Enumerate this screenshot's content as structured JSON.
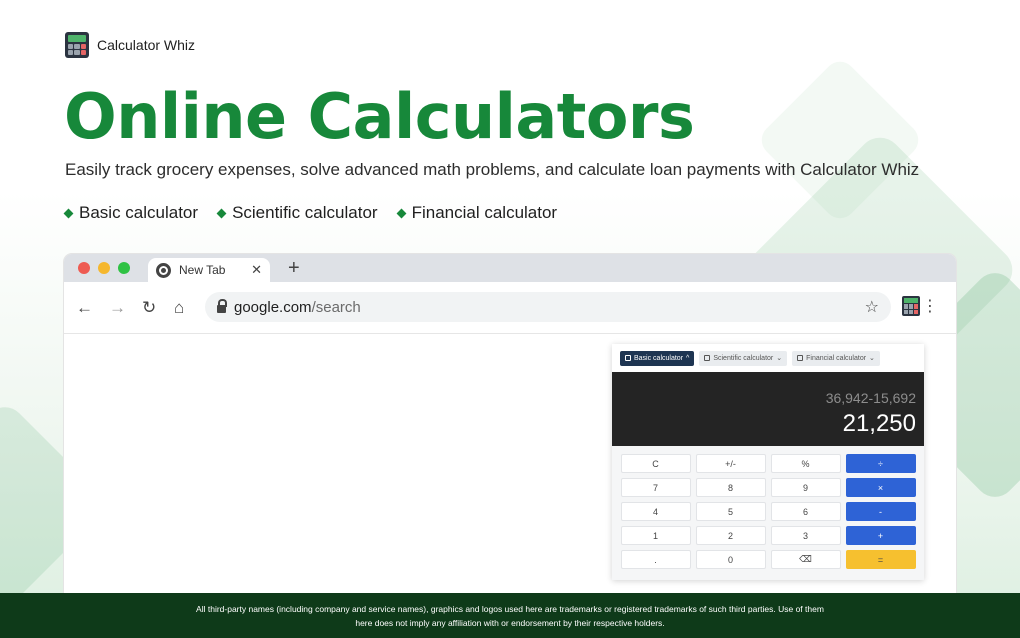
{
  "brand": {
    "name": "Calculator Whiz"
  },
  "headline": "Online Calculators",
  "subheadline": "Easily track grocery expenses, solve advanced math problems, and calculate loan payments with Calculator Whiz",
  "features": [
    "Basic calculator",
    "Scientific calculator",
    "Financial calculator"
  ],
  "browser": {
    "tab_title": "New Tab",
    "tab_close": "✕",
    "new_tab": "+",
    "url_domain": "google.com",
    "url_path": "/search",
    "nav": {
      "back": "←",
      "forward": "→",
      "reload": "↻",
      "home": "⌂"
    },
    "star": "☆",
    "menu": "⋮"
  },
  "calculator": {
    "modes": [
      {
        "label": "Basic calculator",
        "active": true
      },
      {
        "label": "Scientific calculator",
        "active": false
      },
      {
        "label": "Financial calculator",
        "active": false
      }
    ],
    "mode_caret": "⌄",
    "expression": "36,942-15,692",
    "result": "21,250",
    "keys": [
      "C",
      "+/-",
      "%",
      "÷",
      "7",
      "8",
      "9",
      "×",
      "4",
      "5",
      "6",
      "-",
      "1",
      "2",
      "3",
      "+",
      ".",
      "0",
      "⌫",
      "="
    ]
  },
  "footer": {
    "line1": "All third-party names (including company and service names), graphics and logos used here are trademarks or registered trademarks of such third parties. Use of them",
    "line2": "here does not imply any affiliation with or endorsement by their respective holders."
  },
  "colors": {
    "brand_green": "#17883a",
    "operator_blue": "#2e63d6",
    "equals_yellow": "#f6c02f",
    "footer_bg": "#0e3a19"
  }
}
